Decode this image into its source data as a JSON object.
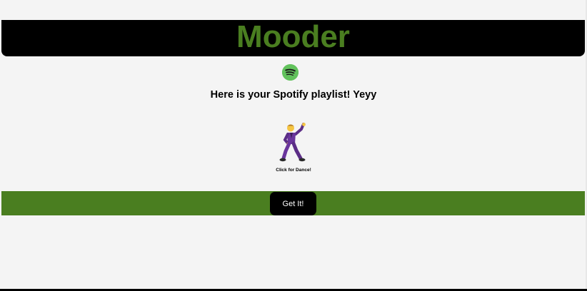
{
  "header": {
    "title": "Mooder",
    "title_color": "#4a7e20",
    "background": "#000000"
  },
  "spotify": {
    "icon": "spotify-icon",
    "color": "#62c25c"
  },
  "main": {
    "message": "Here is your Spotify playlist! Yeyy",
    "dancer_icon": "man-dancing-icon",
    "dance_caption": "Click for Dance!"
  },
  "action_bar": {
    "background": "#4a7e20",
    "button_label": "Get It!",
    "button_color": "#000000"
  }
}
